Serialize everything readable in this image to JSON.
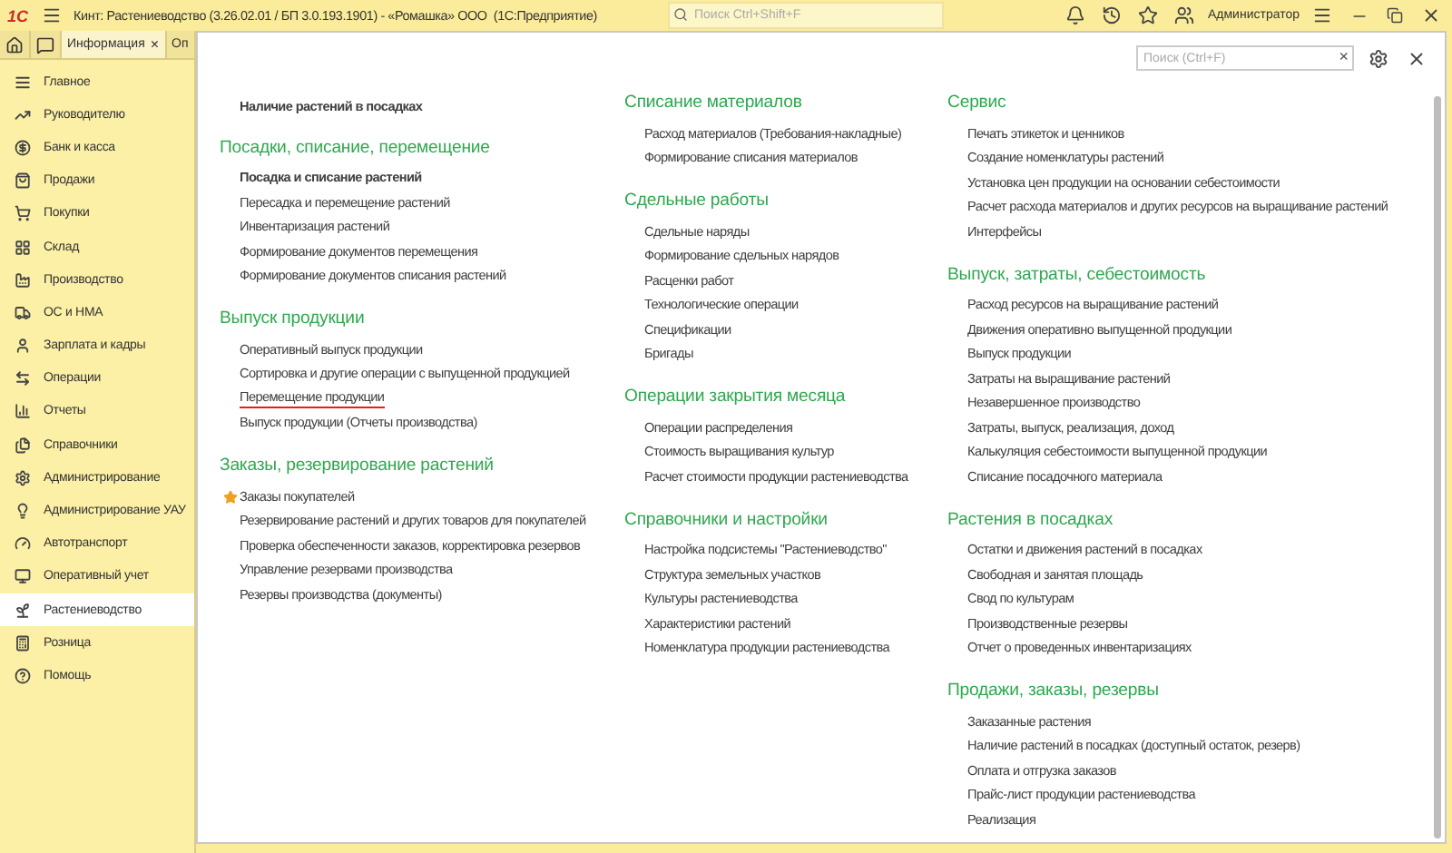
{
  "title_bar": {
    "logo": "1С",
    "title": "Кинт: Растениеводство (3.26.02.01 / БП 3.0.193.1901) - «Ромашка» ООО  (1С:Предприятие)",
    "search": {
      "placeholder": "Поиск Ctrl+Shift+F"
    },
    "user": "Администратор"
  },
  "tabs": [
    {
      "label": "Информация",
      "close": "×",
      "selected": true
    },
    {
      "label": "Оп",
      "selected": false
    }
  ],
  "sidebar": {
    "items": [
      {
        "label": "Главное",
        "selected": false
      },
      {
        "label": "Руководителю",
        "selected": false
      },
      {
        "label": "Банк и касса",
        "selected": false
      },
      {
        "label": "Продажи",
        "selected": false
      },
      {
        "label": "Покупки",
        "selected": false
      },
      {
        "label": "Склад",
        "selected": false
      },
      {
        "label": "Производство",
        "selected": false
      },
      {
        "label": "ОС и НМА",
        "selected": false
      },
      {
        "label": "Зарплата и кадры",
        "selected": false
      },
      {
        "label": "Операции",
        "selected": false
      },
      {
        "label": "Отчеты",
        "selected": false
      },
      {
        "label": "Справочники",
        "selected": false
      },
      {
        "label": "Администрирование",
        "selected": false
      },
      {
        "label": "Администрирование УАУ",
        "selected": false
      },
      {
        "label": "Автотранспорт",
        "selected": false
      },
      {
        "label": "Оперативный учет",
        "selected": false
      },
      {
        "label": "Растениеводство",
        "selected": true
      },
      {
        "label": "Розница",
        "selected": false
      },
      {
        "label": "Помощь",
        "selected": false
      }
    ]
  },
  "panel": {
    "search": {
      "placeholder": "Поиск (Ctrl+F)",
      "clear": "×"
    },
    "columns": [
      {
        "top_items": [
          {
            "label": "Наличие растений в посадках",
            "bold": true
          }
        ],
        "sections": [
          {
            "heading": "Посадки, списание, перемещение",
            "items": [
              {
                "label": "Посадка и списание растений",
                "bold": true
              },
              {
                "label": "Пересадка и перемещение растений"
              },
              {
                "label": "Инвентаризация растений"
              },
              {
                "label": "Формирование документов перемещения"
              },
              {
                "label": "Формирование документов списания растений"
              }
            ]
          },
          {
            "heading": "Выпуск продукции",
            "items": [
              {
                "label": "Оперативный выпуск продукции"
              },
              {
                "label": "Сортировка и другие операции с выпущенной продукцией"
              },
              {
                "label": "Перемещение продукции",
                "underlined": true
              },
              {
                "label": "Выпуск продукции (Отчеты производства)"
              }
            ]
          },
          {
            "heading": "Заказы, резервирование растений",
            "items": [
              {
                "label": "Заказы покупателей",
                "starred": true
              },
              {
                "label": "Резервирование растений и других товаров для покупателей"
              },
              {
                "label": "Проверка обеспеченности заказов, корректировка резервов"
              },
              {
                "label": "Управление резервами производства"
              },
              {
                "label": "Резервы производства (документы)"
              }
            ]
          }
        ]
      },
      {
        "sections": [
          {
            "heading": "Списание материалов",
            "items": [
              {
                "label": "Расход материалов (Требования-накладные)"
              },
              {
                "label": "Формирование списания материалов"
              }
            ]
          },
          {
            "heading": "Сдельные работы",
            "items": [
              {
                "label": "Сдельные наряды"
              },
              {
                "label": "Формирование сдельных нарядов"
              },
              {
                "label": "Расценки работ"
              },
              {
                "label": "Технологические операции"
              },
              {
                "label": "Спецификации"
              },
              {
                "label": "Бригады"
              }
            ]
          },
          {
            "heading": "Операции закрытия месяца",
            "items": [
              {
                "label": "Операции распределения"
              },
              {
                "label": "Стоимость выращивания культур"
              },
              {
                "label": "Расчет стоимости продукции растениеводства"
              }
            ]
          },
          {
            "heading": "Справочники и настройки",
            "items": [
              {
                "label": "Настройка подсистемы \"Растениеводство\""
              },
              {
                "label": "Структура земельных участков"
              },
              {
                "label": "Культуры растениеводства"
              },
              {
                "label": "Характеристики растений"
              },
              {
                "label": "Номенклатура продукции растениеводства"
              }
            ]
          }
        ]
      },
      {
        "sections": [
          {
            "heading": "Сервис",
            "items": [
              {
                "label": "Печать этикеток и ценников"
              },
              {
                "label": "Создание номенклатуры растений"
              },
              {
                "label": "Установка цен продукции на основании себестоимости"
              },
              {
                "label": "Расчет расхода материалов и других ресурсов на выращивание растений"
              },
              {
                "label": "Интерфейсы"
              }
            ]
          },
          {
            "heading": "Выпуск, затраты, себестоимость",
            "items": [
              {
                "label": "Расход ресурсов на выращивание растений"
              },
              {
                "label": "Движения оперативно выпущенной продукции"
              },
              {
                "label": "Выпуск продукции"
              },
              {
                "label": "Затраты на выращивание растений"
              },
              {
                "label": "Незавершенное производство"
              },
              {
                "label": "Затраты, выпуск, реализация, доход"
              },
              {
                "label": "Калькуляция себестоимости выпущенной продукции"
              },
              {
                "label": "Списание посадочного материала"
              }
            ]
          },
          {
            "heading": "Растения в посадках",
            "items": [
              {
                "label": "Остатки и движения растений в посадках"
              },
              {
                "label": "Свободная и занятая площадь"
              },
              {
                "label": "Свод по культурам"
              },
              {
                "label": "Производственные резервы"
              },
              {
                "label": "Отчет о проведенных инвентаризациях"
              }
            ]
          },
          {
            "heading": "Продажи, заказы, резервы",
            "items": [
              {
                "label": "Заказанные растения"
              },
              {
                "label": "Наличие растений в посадках (доступный остаток, резерв)"
              },
              {
                "label": "Оплата и отгрузка заказов"
              },
              {
                "label": "Прайс-лист продукции растениеводства"
              },
              {
                "label": "Реализация"
              }
            ]
          }
        ]
      }
    ]
  }
}
